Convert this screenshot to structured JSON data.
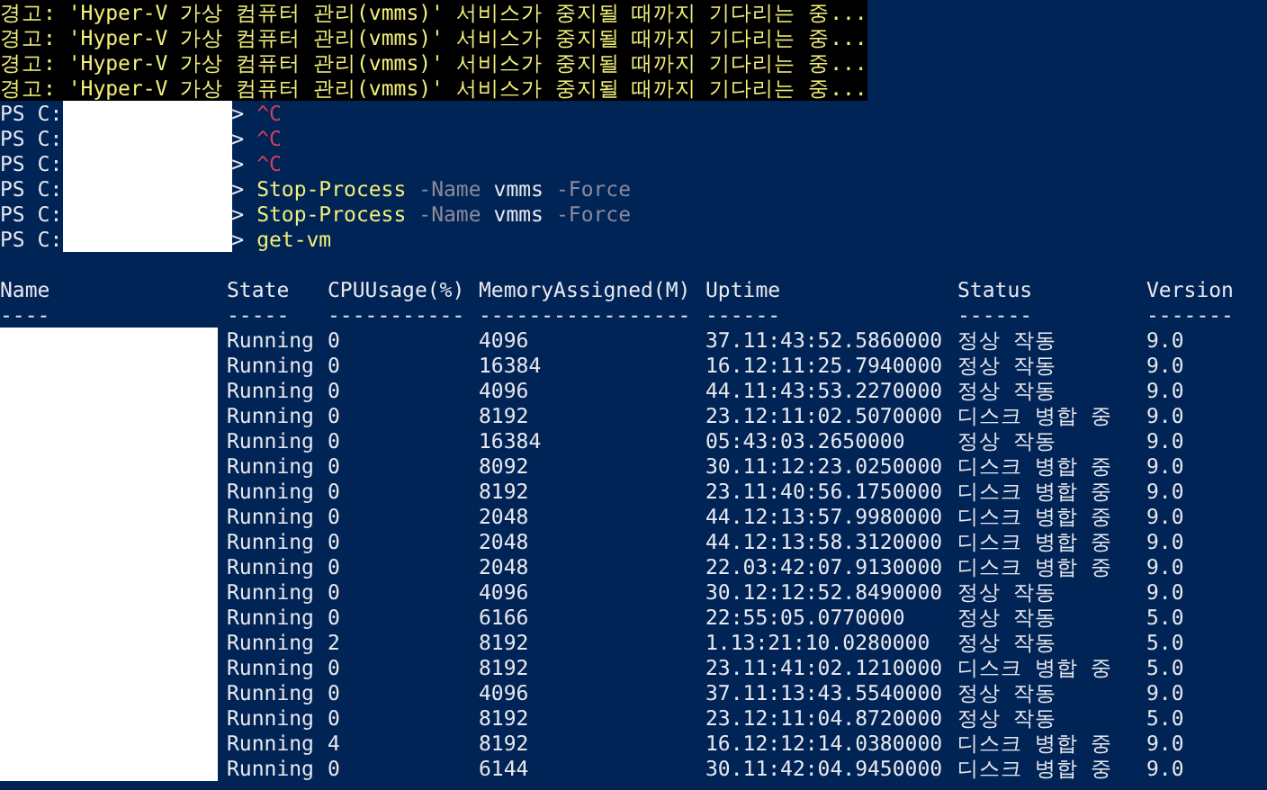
{
  "warnings": [
    "경고: 'Hyper-V 가상 컴퓨터 관리(vmms)' 서비스가 중지될 때까지 기다리는 중...",
    "경고: 'Hyper-V 가상 컴퓨터 관리(vmms)' 서비스가 중지될 때까지 기다리는 중...",
    "경고: 'Hyper-V 가상 컴퓨터 관리(vmms)' 서비스가 중지될 때까지 기다리는 중...",
    "경고: 'Hyper-V 가상 컴퓨터 관리(vmms)' 서비스가 중지될 때까지 기다리는 중..."
  ],
  "prompts": [
    {
      "prefix": "PS C:",
      "path_redacted": true,
      "suffix": ">",
      "tokens": [
        {
          "kind": "error",
          "text": "^C"
        }
      ]
    },
    {
      "prefix": "PS C:",
      "path_redacted": true,
      "suffix": ">",
      "tokens": [
        {
          "kind": "error",
          "text": "^C"
        }
      ]
    },
    {
      "prefix": "PS C:",
      "path_redacted": true,
      "suffix": ">",
      "tokens": [
        {
          "kind": "error",
          "text": "^C"
        }
      ]
    },
    {
      "prefix": "PS C:",
      "path_redacted": true,
      "suffix": ">",
      "tokens": [
        {
          "kind": "command",
          "text": "Stop-Process"
        },
        {
          "kind": "parameter",
          "text": "-Name"
        },
        {
          "kind": "argument",
          "text": "vmms"
        },
        {
          "kind": "parameter",
          "text": "-Force"
        }
      ]
    },
    {
      "prefix": "PS C:",
      "path_redacted": true,
      "suffix": ">",
      "tokens": [
        {
          "kind": "command",
          "text": "Stop-Process"
        },
        {
          "kind": "parameter",
          "text": "-Name"
        },
        {
          "kind": "argument",
          "text": "vmms"
        },
        {
          "kind": "parameter",
          "text": "-Force"
        }
      ]
    },
    {
      "prefix": "PS C:",
      "path_redacted": true,
      "suffix": ">",
      "tokens": [
        {
          "kind": "command",
          "text": "get-vm"
        }
      ]
    }
  ],
  "table": {
    "columns": [
      "Name",
      "State",
      "CPUUsage(%)",
      "MemoryAssigned(M)",
      "Uptime",
      "Status",
      "Version"
    ],
    "rules": [
      "----",
      "-----",
      "-----------",
      "-----------------",
      "------",
      "------",
      "-------"
    ],
    "names_redacted": true,
    "rows": [
      [
        "",
        "Running",
        "0",
        "4096",
        "37.11:43:52.5860000",
        "정상 작동",
        "9.0"
      ],
      [
        "",
        "Running",
        "0",
        "16384",
        "16.12:11:25.7940000",
        "정상 작동",
        "9.0"
      ],
      [
        "",
        "Running",
        "0",
        "4096",
        "44.11:43:53.2270000",
        "정상 작동",
        "9.0"
      ],
      [
        "",
        "Running",
        "0",
        "8192",
        "23.12:11:02.5070000",
        "디스크 병합 중",
        "9.0"
      ],
      [
        "",
        "Running",
        "0",
        "16384",
        "05:43:03.2650000",
        "정상 작동",
        "9.0"
      ],
      [
        "",
        "Running",
        "0",
        "8092",
        "30.11:12:23.0250000",
        "디스크 병합 중",
        "9.0"
      ],
      [
        "",
        "Running",
        "0",
        "8192",
        "23.11:40:56.1750000",
        "디스크 병합 중",
        "9.0"
      ],
      [
        "",
        "Running",
        "0",
        "2048",
        "44.12:13:57.9980000",
        "디스크 병합 중",
        "9.0"
      ],
      [
        "",
        "Running",
        "0",
        "2048",
        "44.12:13:58.3120000",
        "디스크 병합 중",
        "9.0"
      ],
      [
        "",
        "Running",
        "0",
        "2048",
        "22.03:42:07.9130000",
        "디스크 병합 중",
        "9.0"
      ],
      [
        "",
        "Running",
        "0",
        "4096",
        "30.12:12:52.8490000",
        "정상 작동",
        "9.0"
      ],
      [
        "",
        "Running",
        "0",
        "6166",
        "22:55:05.0770000",
        "정상 작동",
        "5.0"
      ],
      [
        "",
        "Running",
        "2",
        "8192",
        "1.13:21:10.0280000",
        "정상 작동",
        "5.0"
      ],
      [
        "",
        "Running",
        "0",
        "8192",
        "23.11:41:02.1210000",
        "디스크 병합 중",
        "5.0"
      ],
      [
        "",
        "Running",
        "0",
        "4096",
        "37.11:13:43.5540000",
        "정상 작동",
        "9.0"
      ],
      [
        "",
        "Running",
        "0",
        "8192",
        "23.12:11:04.8720000",
        "정상 작동",
        "5.0"
      ],
      [
        "",
        "Running",
        "4",
        "8192",
        "16.12:12:14.0380000",
        "디스크 병합 중",
        "9.0"
      ],
      [
        "",
        "Running",
        "0",
        "6144",
        "30.11:42:04.9450000",
        "디스크 병합 중",
        "9.0"
      ]
    ]
  }
}
